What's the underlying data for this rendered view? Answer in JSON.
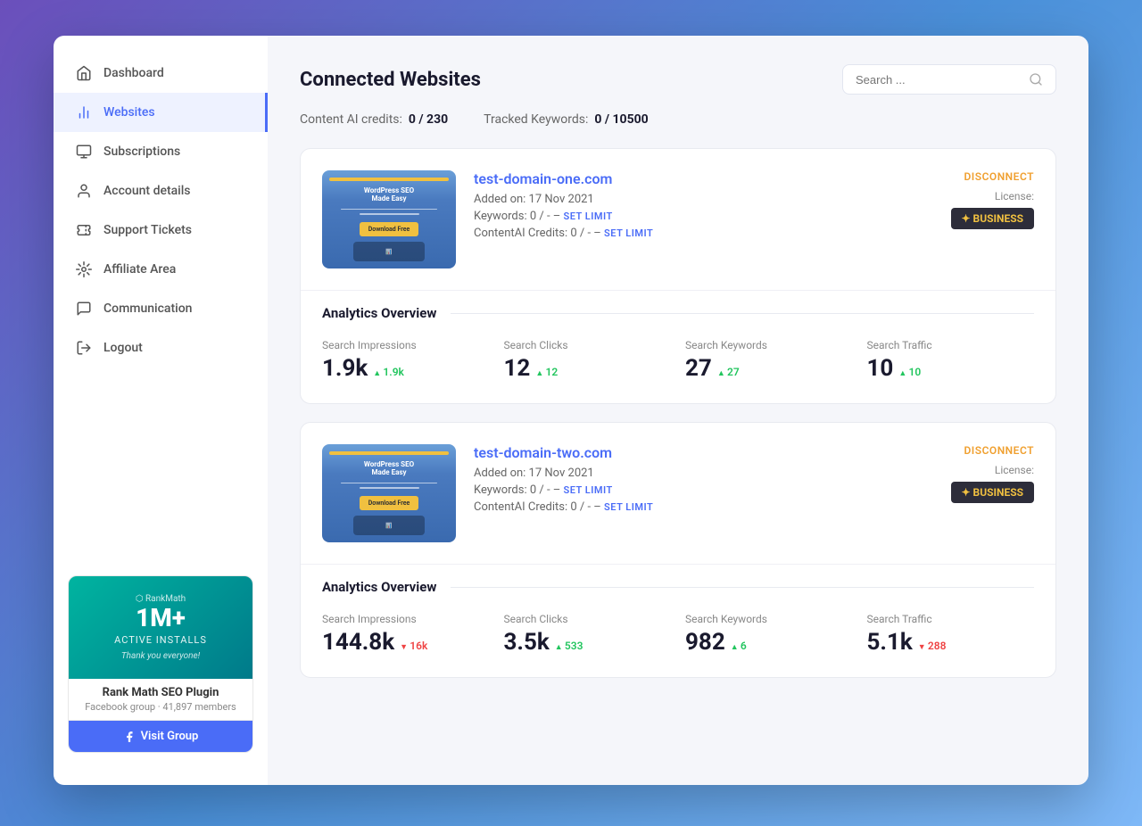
{
  "sidebar": {
    "items": [
      {
        "id": "dashboard",
        "label": "Dashboard",
        "icon": "home"
      },
      {
        "id": "websites",
        "label": "Websites",
        "icon": "chart-bar",
        "active": true
      },
      {
        "id": "subscriptions",
        "label": "Subscriptions",
        "icon": "receipt"
      },
      {
        "id": "account",
        "label": "Account details",
        "icon": "user"
      },
      {
        "id": "support",
        "label": "Support Tickets",
        "icon": "ticket"
      },
      {
        "id": "affiliate",
        "label": "Affiliate Area",
        "icon": "affiliate"
      },
      {
        "id": "communication",
        "label": "Communication",
        "icon": "chat"
      },
      {
        "id": "logout",
        "label": "Logout",
        "icon": "logout"
      }
    ],
    "banner": {
      "installs": "1M+",
      "installs_label": "ACTIVE INSTALLS",
      "tagline": "Thank you everyone!",
      "title": "Rank Math SEO Plugin",
      "meta": "Facebook group · 41,897 members",
      "cta_label": "Visit Group"
    }
  },
  "header": {
    "title": "Connected Websites",
    "search_placeholder": "Search ..."
  },
  "credits": {
    "ai_label": "Content AI credits:",
    "ai_value": "0 / 230",
    "keywords_label": "Tracked Keywords:",
    "keywords_value": "0 / 10500"
  },
  "websites": [
    {
      "domain": "test-domain-one.com",
      "added_on": "Added on: 17 Nov 2021",
      "keywords_label": "Keywords:",
      "keywords_value": "0 / -",
      "content_ai_label": "ContentAI Credits:",
      "content_ai_value": "0 / -",
      "license_label": "License:",
      "license_badge": "✦ BUSINESS",
      "disconnect_label": "DISCONNECT",
      "analytics": {
        "title": "Analytics Overview",
        "items": [
          {
            "label": "Search Impressions",
            "value": "1.9k",
            "change": "1.9k",
            "direction": "up"
          },
          {
            "label": "Search Clicks",
            "value": "12",
            "change": "12",
            "direction": "up"
          },
          {
            "label": "Search Keywords",
            "value": "27",
            "change": "27",
            "direction": "up"
          },
          {
            "label": "Search Traffic",
            "value": "10",
            "change": "10",
            "direction": "up"
          }
        ]
      }
    },
    {
      "domain": "test-domain-two.com",
      "added_on": "Added on: 17 Nov 2021",
      "keywords_label": "Keywords:",
      "keywords_value": "0 / -",
      "content_ai_label": "ContentAI Credits:",
      "content_ai_value": "0 / -",
      "license_label": "License:",
      "license_badge": "✦ BUSINESS",
      "disconnect_label": "DISCONNECT",
      "analytics": {
        "title": "Analytics Overview",
        "items": [
          {
            "label": "Search Impressions",
            "value": "144.8k",
            "change": "16k",
            "direction": "down"
          },
          {
            "label": "Search Clicks",
            "value": "3.5k",
            "change": "533",
            "direction": "up"
          },
          {
            "label": "Search Keywords",
            "value": "982",
            "change": "6",
            "direction": "up"
          },
          {
            "label": "Search Traffic",
            "value": "5.1k",
            "change": "288",
            "direction": "down"
          }
        ]
      }
    }
  ]
}
